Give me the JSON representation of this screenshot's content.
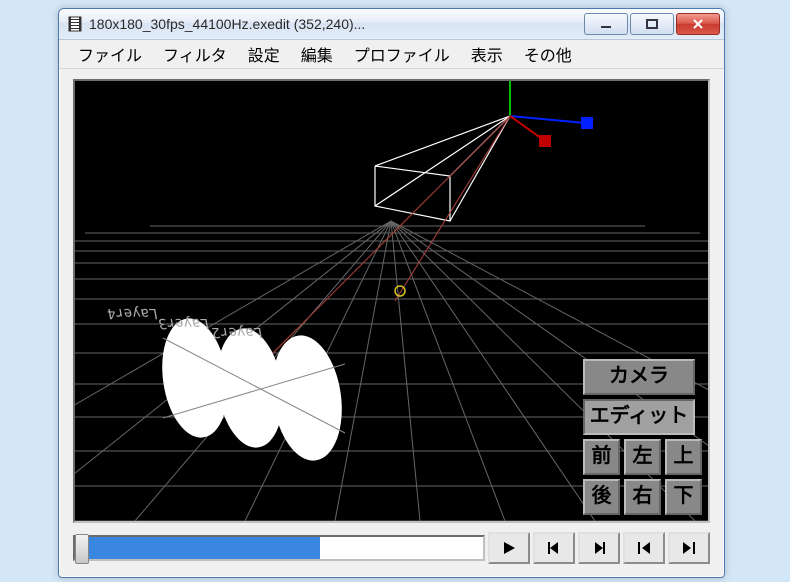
{
  "window": {
    "title": "180x180_30fps_44100Hz.exedit (352,240)..."
  },
  "menu": {
    "file": "ファイル",
    "filter": "フィルタ",
    "settings": "設定",
    "edit": "編集",
    "profile": "プロファイル",
    "view": "表示",
    "other": "その他"
  },
  "layers": {
    "l0": "Layer2",
    "l1": "Layer3",
    "l2": "Layer4"
  },
  "nav": {
    "camera": "カメラ",
    "edit": "エディット",
    "front": "前",
    "back": "後",
    "left": "左",
    "right": "右",
    "top": "上",
    "bottom": "下"
  },
  "seek": {
    "progress_percent": 60
  }
}
